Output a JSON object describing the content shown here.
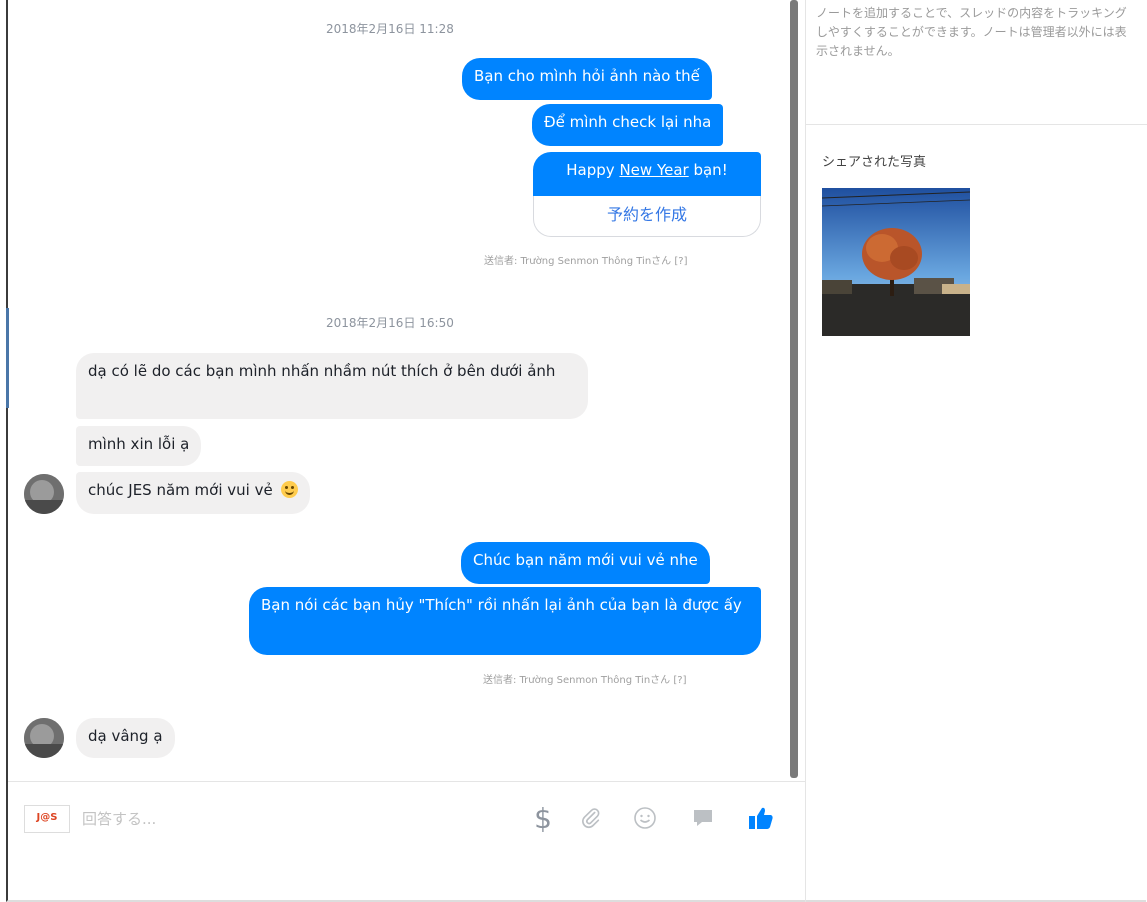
{
  "chat": {
    "timestamps": [
      "2018年2月16日 11:28",
      "2018年2月16日 16:50"
    ],
    "messages": [
      "Bạn cho mình hỏi ảnh nào thế",
      "Để mình check lại nha",
      "dạ có lẽ do các bạn mình nhấn nhầm nút thích ở bên dưới ảnh",
      "mình xin lỗi ạ",
      "chúc JES năm mới vui vẻ",
      "Chúc bạn năm mới vui vẻ nhe",
      "Bạn nói các bạn hủy \"Thích\" rồi nhấn lại ảnh của bạn là được ấy",
      "dạ vâng ạ"
    ],
    "happy": {
      "pre": "Happy ",
      "link": "New Year",
      "post": " bạn!"
    },
    "reservation": "予約を作成",
    "sender_labels": [
      "送信者: Trường Senmon Thông Tinさん [?]",
      "送信者: Trường Senmon Thông Tinさん [?]"
    ]
  },
  "composer": {
    "logo": "J@S",
    "placeholder": "回答する..."
  },
  "sidebar": {
    "note": "ノートを追加することで、スレッドの内容をトラッキングしやすくすることができます。ノートは管理者以外には表示されません。",
    "shared_photos_title": "シェアされた写真"
  },
  "colors": {
    "outgoing": "#0084ff",
    "incoming": "#f1f0f0",
    "like": "#0084ff"
  },
  "icons": [
    "dollar-icon",
    "paperclip-icon",
    "smiley-icon",
    "chat-icon",
    "thumbs-up-icon"
  ]
}
